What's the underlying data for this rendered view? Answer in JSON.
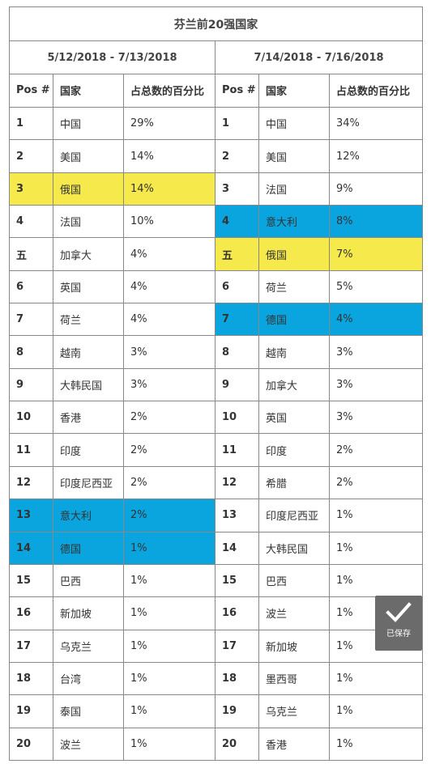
{
  "title": "芬兰前20强国家",
  "left": {
    "date_range": "5/12/2018 - 7/13/2018",
    "headers": [
      "Pos #",
      "国家",
      "占总数的百分比"
    ],
    "rows": [
      {
        "pos": "1",
        "country": "中国",
        "pct": "29%",
        "hl": ""
      },
      {
        "pos": "2",
        "country": "美国",
        "pct": "14%",
        "hl": ""
      },
      {
        "pos": "3",
        "country": "俄国",
        "pct": "14%",
        "hl": "yellow"
      },
      {
        "pos": "4",
        "country": "法国",
        "pct": "10%",
        "hl": ""
      },
      {
        "pos": "五",
        "country": "加拿大",
        "pct": "4%",
        "hl": ""
      },
      {
        "pos": "6",
        "country": "英国",
        "pct": "4%",
        "hl": ""
      },
      {
        "pos": "7",
        "country": "荷兰",
        "pct": "4%",
        "hl": ""
      },
      {
        "pos": "8",
        "country": "越南",
        "pct": "3%",
        "hl": ""
      },
      {
        "pos": "9",
        "country": "大韩民国",
        "pct": "3%",
        "hl": ""
      },
      {
        "pos": "10",
        "country": "香港",
        "pct": "2%",
        "hl": ""
      },
      {
        "pos": "11",
        "country": "印度",
        "pct": "2%",
        "hl": ""
      },
      {
        "pos": "12",
        "country": "印度尼西亚",
        "pct": "2%",
        "hl": ""
      },
      {
        "pos": "13",
        "country": "意大利",
        "pct": "2%",
        "hl": "blue"
      },
      {
        "pos": "14",
        "country": "德国",
        "pct": "1%",
        "hl": "blue"
      },
      {
        "pos": "15",
        "country": "巴西",
        "pct": "1%",
        "hl": ""
      },
      {
        "pos": "16",
        "country": "新加坡",
        "pct": "1%",
        "hl": ""
      },
      {
        "pos": "17",
        "country": "乌克兰",
        "pct": "1%",
        "hl": ""
      },
      {
        "pos": "18",
        "country": "台湾",
        "pct": "1%",
        "hl": ""
      },
      {
        "pos": "19",
        "country": "泰国",
        "pct": "1%",
        "hl": ""
      },
      {
        "pos": "20",
        "country": "波兰",
        "pct": "1%",
        "hl": ""
      }
    ]
  },
  "right": {
    "date_range": "7/14/2018 - 7/16/2018",
    "headers": [
      "Pos #",
      "国家",
      "占总数的百分比"
    ],
    "rows": [
      {
        "pos": "1",
        "country": "中国",
        "pct": "34%",
        "hl": ""
      },
      {
        "pos": "2",
        "country": "美国",
        "pct": "12%",
        "hl": ""
      },
      {
        "pos": "3",
        "country": "法国",
        "pct": "9%",
        "hl": ""
      },
      {
        "pos": "4",
        "country": "意大利",
        "pct": "8%",
        "hl": "blue"
      },
      {
        "pos": "五",
        "country": "俄国",
        "pct": "7%",
        "hl": "yellow"
      },
      {
        "pos": "6",
        "country": "荷兰",
        "pct": "5%",
        "hl": ""
      },
      {
        "pos": "7",
        "country": "德国",
        "pct": "4%",
        "hl": "blue"
      },
      {
        "pos": "8",
        "country": "越南",
        "pct": "3%",
        "hl": ""
      },
      {
        "pos": "9",
        "country": "加拿大",
        "pct": "3%",
        "hl": ""
      },
      {
        "pos": "10",
        "country": "英国",
        "pct": "3%",
        "hl": ""
      },
      {
        "pos": "11",
        "country": "印度",
        "pct": "2%",
        "hl": ""
      },
      {
        "pos": "12",
        "country": "希腊",
        "pct": "2%",
        "hl": ""
      },
      {
        "pos": "13",
        "country": "印度尼西亚",
        "pct": "1%",
        "hl": ""
      },
      {
        "pos": "14",
        "country": "大韩民国",
        "pct": "1%",
        "hl": ""
      },
      {
        "pos": "15",
        "country": "巴西",
        "pct": "1%",
        "hl": ""
      },
      {
        "pos": "16",
        "country": "波兰",
        "pct": "1%",
        "hl": ""
      },
      {
        "pos": "17",
        "country": "新加坡",
        "pct": "1%",
        "hl": ""
      },
      {
        "pos": "18",
        "country": "墨西哥",
        "pct": "1%",
        "hl": ""
      },
      {
        "pos": "19",
        "country": "乌克兰",
        "pct": "1%",
        "hl": ""
      },
      {
        "pos": "20",
        "country": "香港",
        "pct": "1%",
        "hl": ""
      }
    ]
  },
  "saved_badge": {
    "label": "已保存",
    "icon": "checkmark-icon"
  },
  "colors": {
    "highlight_yellow": "#f5e94b",
    "highlight_blue": "#0aa5df",
    "badge_bg": "#6b6b6b"
  }
}
